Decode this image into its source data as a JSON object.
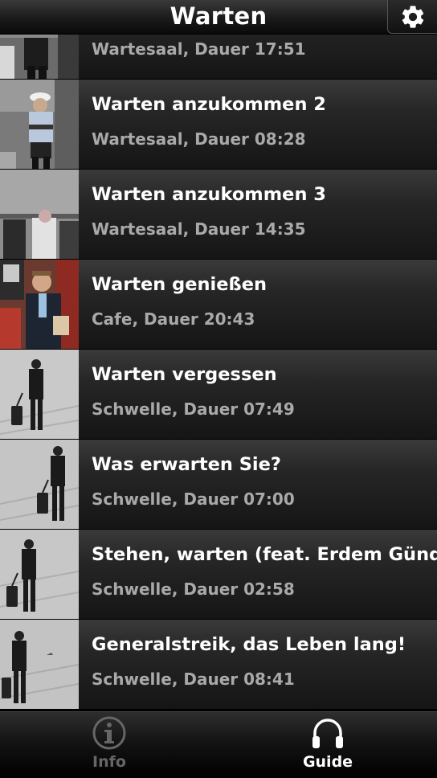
{
  "header": {
    "title": "Warten",
    "settings_icon": "gear-icon"
  },
  "list": {
    "items": [
      {
        "title": "",
        "subtitle": "Wartesaal, Dauer 17:51",
        "thumb": "police-officer"
      },
      {
        "title": "Warten anzukommen 2",
        "subtitle": "Wartesaal, Dauer 08:28",
        "thumb": "police-officer"
      },
      {
        "title": "Warten anzukommen 3",
        "subtitle": "Wartesaal, Dauer 14:35",
        "thumb": "waiting-room"
      },
      {
        "title": "Warten genießen",
        "subtitle": "Cafe, Dauer 20:43",
        "thumb": "man-in-cafe"
      },
      {
        "title": "Warten vergessen",
        "subtitle": "Schwelle, Dauer 07:49",
        "thumb": "traveler-with-suitcase"
      },
      {
        "title": "Was erwarten Sie?",
        "subtitle": "Schwelle, Dauer 07:00",
        "thumb": "traveler-with-suitcase"
      },
      {
        "title": "Stehen, warten (feat. Erdem Gündüz)",
        "subtitle": "Schwelle, Dauer 02:58",
        "thumb": "traveler-with-suitcase"
      },
      {
        "title": "Generalstreik, das Leben lang!",
        "subtitle": "Schwelle, Dauer 08:41",
        "thumb": "traveler-with-suitcase"
      }
    ]
  },
  "tabbar": {
    "tabs": [
      {
        "label": "Info",
        "icon": "info-icon",
        "active": false
      },
      {
        "label": "Guide",
        "icon": "headphones-icon",
        "active": true
      }
    ]
  }
}
